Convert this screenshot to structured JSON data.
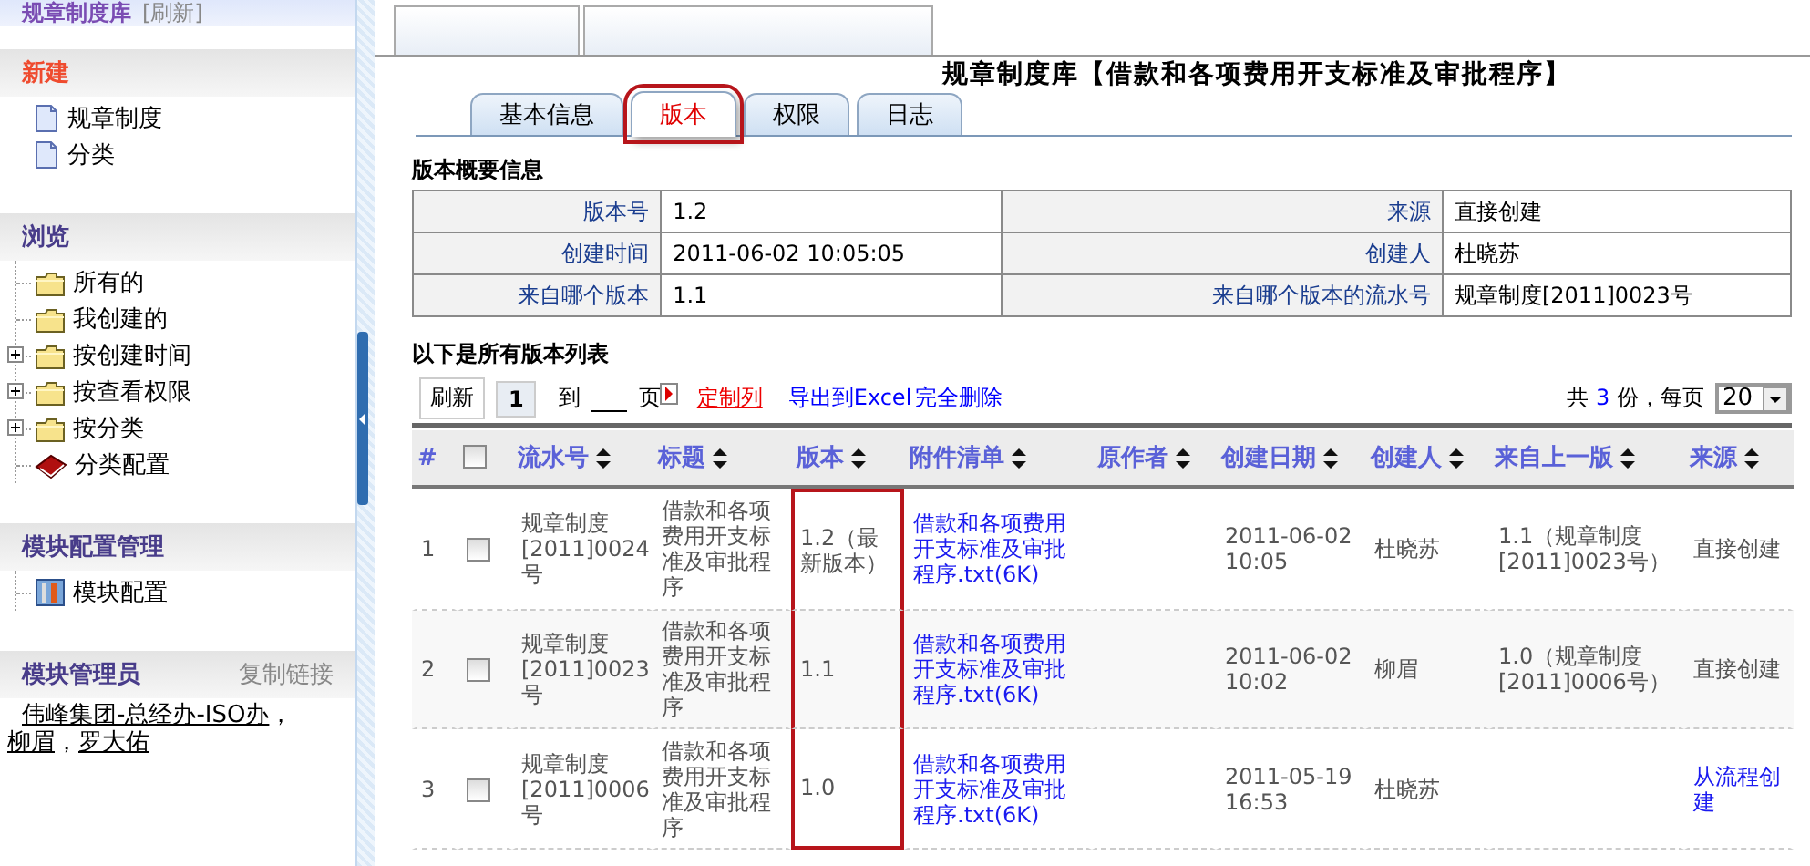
{
  "sidebar": {
    "header": {
      "title": "规章制度库",
      "refresh": "[刷新]"
    },
    "sections": [
      {
        "title": "新建",
        "accent": true,
        "kind": "list",
        "items": [
          {
            "kind": "document",
            "label": "规章制度",
            "expandable": false
          },
          {
            "kind": "document",
            "label": "分类",
            "expandable": false
          }
        ]
      },
      {
        "title": "浏览",
        "accent": false,
        "kind": "tree",
        "items": [
          {
            "kind": "folder",
            "label": "所有的",
            "expandable": false
          },
          {
            "kind": "folder",
            "label": "我创建的",
            "expandable": false
          },
          {
            "kind": "folder",
            "label": "按创建时间",
            "expandable": true
          },
          {
            "kind": "folder",
            "label": "按查看权限",
            "expandable": true
          },
          {
            "kind": "folder",
            "label": "按分类",
            "expandable": true
          },
          {
            "kind": "book",
            "label": "分类配置",
            "expandable": false
          }
        ]
      },
      {
        "title": "模块配置管理",
        "accent": false,
        "kind": "tree",
        "items": [
          {
            "kind": "tool",
            "label": "模块配置",
            "expandable": false
          }
        ]
      }
    ],
    "admins": {
      "title": "模块管理员",
      "copy_link": "复制链接",
      "separator": "，",
      "people": [
        "伟峰集团-总经办-ISO办",
        "柳眉",
        "罗大佑"
      ]
    }
  },
  "main": {
    "title": "规章制度库【借款和各项费用开支标准及审批程序】",
    "tabs": [
      {
        "label": "基本信息",
        "selected": false,
        "highlighted": false
      },
      {
        "label": "版本",
        "selected": true,
        "highlighted": true
      },
      {
        "label": "权限",
        "selected": false,
        "highlighted": false
      },
      {
        "label": "日志",
        "selected": false,
        "highlighted": false
      }
    ],
    "summary": {
      "heading": "版本概要信息",
      "rows": [
        [
          {
            "label": "版本号",
            "value": "1.2"
          },
          {
            "label": "来源",
            "value": "直接创建"
          }
        ],
        [
          {
            "label": "创建时间",
            "value": "2011-06-02 10:05:05"
          },
          {
            "label": "创建人",
            "value": "杜晓苏"
          }
        ],
        [
          {
            "label": "来自哪个版本",
            "value": "1.1"
          },
          {
            "label": "来自哪个版本的流水号",
            "value": "规章制度[2011]0023号"
          }
        ]
      ]
    },
    "list": {
      "heading": "以下是所有版本列表",
      "toolbar": {
        "refresh": "刷新",
        "page": "1",
        "to": "到",
        "page_unit": "页",
        "customize": "定制列",
        "export": "导出到Excel",
        "delete": "完全删除",
        "total_prefix": "共",
        "total": "3",
        "total_suffix": "份，每页",
        "page_size": "20"
      },
      "columns": [
        {
          "label": "#",
          "sortable": false,
          "highlighted": false
        },
        {
          "kind": "checkbox",
          "highlighted": false,
          "checked": false
        },
        {
          "label": "流水号",
          "sortable": true,
          "highlighted": false
        },
        {
          "label": "标题",
          "sortable": true,
          "highlighted": false
        },
        {
          "label": "版本",
          "sortable": true,
          "highlighted": true
        },
        {
          "label": "附件清单",
          "sortable": true,
          "highlighted": false
        },
        {
          "label": "原作者",
          "sortable": true,
          "highlighted": false
        },
        {
          "label": "创建日期",
          "sortable": true,
          "highlighted": false
        },
        {
          "label": "创建人",
          "sortable": true,
          "highlighted": false
        },
        {
          "label": "来自上一版",
          "sortable": true,
          "highlighted": false
        },
        {
          "label": "来源",
          "sortable": true,
          "highlighted": false
        }
      ],
      "rows": [
        {
          "cells": [
            {
              "text": "1"
            },
            {
              "checked": false
            },
            {
              "text": "规章制度[2011]0024号"
            },
            {
              "text": "借款和各项费用开支标准及审批程序"
            },
            {
              "text": "1.2（最新版本）"
            },
            {
              "text": "借款和各项费用开支标准及审批程序.txt(6K)",
              "link": true
            },
            {},
            {
              "text": "2011-06-02 10:05"
            },
            {
              "text": "杜晓苏"
            },
            {
              "text": "1.1（规章制度[2011]0023号）"
            },
            {
              "text": "直接创建",
              "link": false
            }
          ]
        },
        {
          "cells": [
            {
              "text": "2"
            },
            {
              "checked": false
            },
            {
              "text": "规章制度[2011]0023号"
            },
            {
              "text": "借款和各项费用开支标准及审批程序"
            },
            {
              "text": "1.1"
            },
            {
              "text": "借款和各项费用开支标准及审批程序.txt(6K)",
              "link": true
            },
            {},
            {
              "text": "2011-06-02 10:02"
            },
            {
              "text": "柳眉"
            },
            {
              "text": "1.0（规章制度[2011]0006号）"
            },
            {
              "text": "直接创建",
              "link": false
            }
          ]
        },
        {
          "cells": [
            {
              "text": "3"
            },
            {
              "checked": false
            },
            {
              "text": "规章制度[2011]0006号"
            },
            {
              "text": "借款和各项费用开支标准及审批程序"
            },
            {
              "text": "1.0"
            },
            {
              "text": "借款和各项费用开支标准及审批程序.txt(6K)",
              "link": true
            },
            {},
            {
              "text": "2011-05-19 16:53"
            },
            {
              "text": "杜晓苏"
            },
            {},
            {
              "text": "从流程创建",
              "link": true
            }
          ]
        }
      ]
    }
  }
}
